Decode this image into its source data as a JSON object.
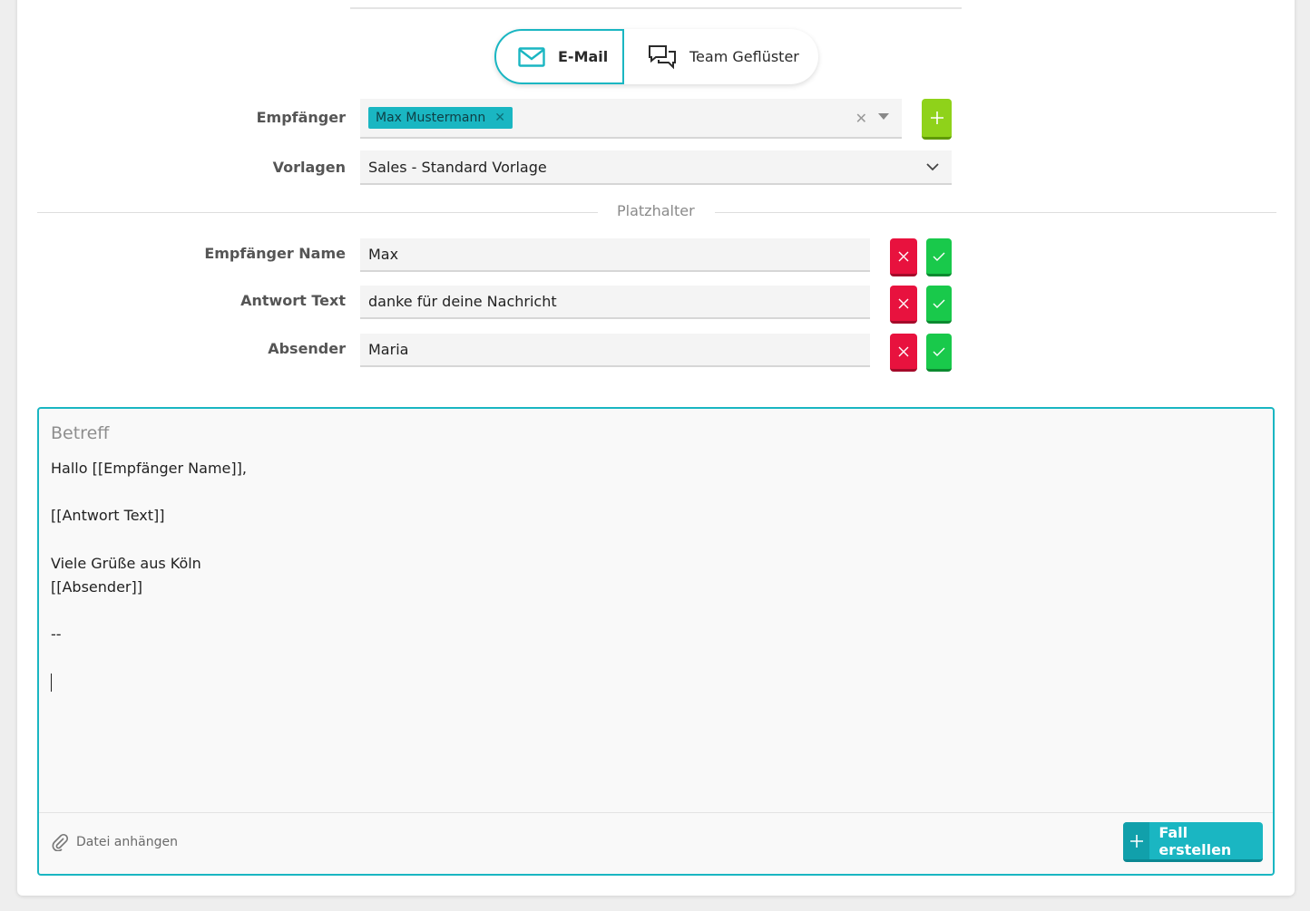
{
  "channels": {
    "email_label": "E-Mail",
    "team_label": "Team Geflüster"
  },
  "form": {
    "recipient_label": "Empfänger",
    "recipient_tag": "Max Mustermann",
    "template_label": "Vorlagen",
    "template_value": "Sales - Standard Vorlage"
  },
  "placeholders": {
    "section_title": "Platzhalter",
    "rows": [
      {
        "label": "Empfänger Name",
        "value": "Max"
      },
      {
        "label": "Antwort Text",
        "value": "danke für deine Nachricht"
      },
      {
        "label": "Absender",
        "value": "Maria"
      }
    ]
  },
  "editor": {
    "subject_placeholder": "Betreff",
    "body": "Hallo [[Empfänger Name]],\n\n[[Antwort Text]]\n\nViele Grüße aus Köln\n[[Absender]]\n\n--",
    "attach_label": "Datei anhängen",
    "create_label": "Fall erstellen"
  },
  "colors": {
    "accent": "#1ab6c2",
    "danger": "#e8123e",
    "success": "#19c94b",
    "add": "#8fd21a"
  }
}
